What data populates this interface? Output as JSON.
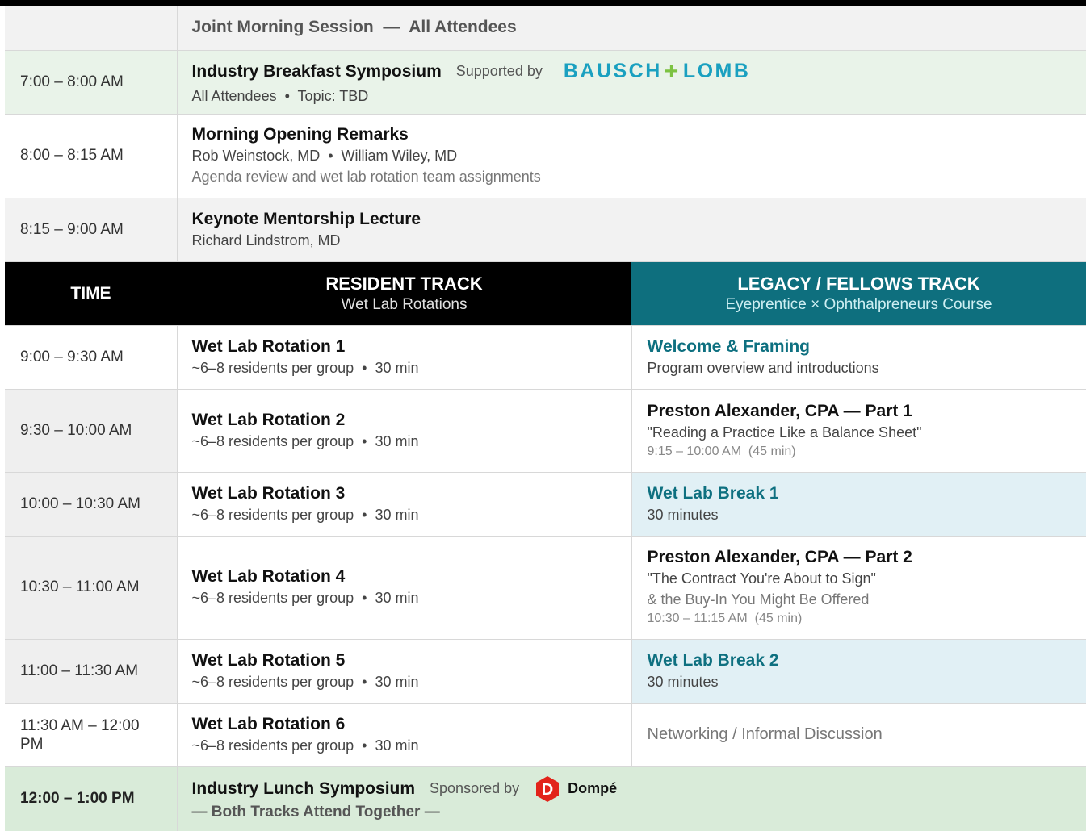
{
  "joint_header": "Joint Morning Session  —  All Attendees",
  "breakfast": {
    "time": "7:00 – 8:00 AM",
    "title": "Industry Breakfast Symposium",
    "supported_label": "Supported by",
    "sponsor_left": "BAUSCH",
    "sponsor_plus": "+",
    "sponsor_right": "LOMB",
    "detail": "All Attendees  •  Topic: TBD"
  },
  "opening": {
    "time": "8:00 – 8:15 AM",
    "title": "Morning Opening Remarks",
    "speakers": "Rob Weinstock, MD  •  William Wiley, MD",
    "note": "Agenda review and wet lab rotation team assignments"
  },
  "keynote": {
    "time": "8:15 – 9:00 AM",
    "title": "Keynote Mentorship Lecture",
    "speaker": "Richard Lindstrom, MD"
  },
  "track_header": {
    "time": "TIME",
    "resident_title": "RESIDENT TRACK",
    "resident_sub": "Wet Lab Rotations",
    "legacy_title": "LEGACY / FELLOWS TRACK",
    "legacy_sub": "Eyeprentice × Ophthalpreneurs Course"
  },
  "rows": [
    {
      "time": "9:00 – 9:30 AM",
      "resident_title": "Wet Lab Rotation 1",
      "resident_sub": "~6–8 residents per group  •  30 min",
      "legacy_title": "Welcome & Framing",
      "legacy_sub": "Program overview and introductions"
    },
    {
      "time": "9:30 – 10:00 AM",
      "resident_title": "Wet Lab Rotation 2",
      "resident_sub": "~6–8 residents per group  •  30 min",
      "legacy_title": "Preston Alexander, CPA — Part 1",
      "legacy_sub": "\"Reading a Practice Like a Balance Sheet\"",
      "legacy_note": "9:15 – 10:00 AM  (45 min)"
    },
    {
      "time": "10:00 – 10:30 AM",
      "resident_title": "Wet Lab Rotation 3",
      "resident_sub": "~6–8 residents per group  •  30 min",
      "legacy_title": "Wet Lab Break 1",
      "legacy_sub": "30 minutes"
    },
    {
      "time": "10:30 – 11:00 AM",
      "resident_title": "Wet Lab Rotation 4",
      "resident_sub": "~6–8 residents per group  •  30 min",
      "legacy_title": "Preston Alexander, CPA — Part 2",
      "legacy_sub": "\"The Contract You're About to Sign\"",
      "legacy_sub2": "& the Buy-In You Might Be Offered",
      "legacy_note": "10:30 – 11:15 AM  (45 min)"
    },
    {
      "time": "11:00 – 11:30 AM",
      "resident_title": "Wet Lab Rotation 5",
      "resident_sub": "~6–8 residents per group  •  30 min",
      "legacy_title": "Wet Lab Break 2",
      "legacy_sub": "30 minutes"
    },
    {
      "time": "11:30 AM – 12:00 PM",
      "resident_title": "Wet Lab Rotation 6",
      "resident_sub": "~6–8 residents per group  •  30 min",
      "legacy_text": "Networking / Informal Discussion"
    }
  ],
  "lunch": {
    "time": "12:00 – 1:00 PM",
    "title": "Industry Lunch Symposium",
    "sponsored_label": "Sponsored by",
    "sponsor_letter": "D",
    "sponsor_name": "Dompé",
    "detail": "— Both Tracks Attend Together —"
  },
  "colors": {
    "teal": "#0e7080",
    "legacy_header": "#0e6f7e",
    "break_bg": "#e1f0f5",
    "green_bg": "#e9f3e9",
    "lunch_bg": "#d9ebd9",
    "bausch_blue": "#1aa0c0",
    "bausch_green": "#7cc242",
    "dompe_red": "#e2231a"
  }
}
